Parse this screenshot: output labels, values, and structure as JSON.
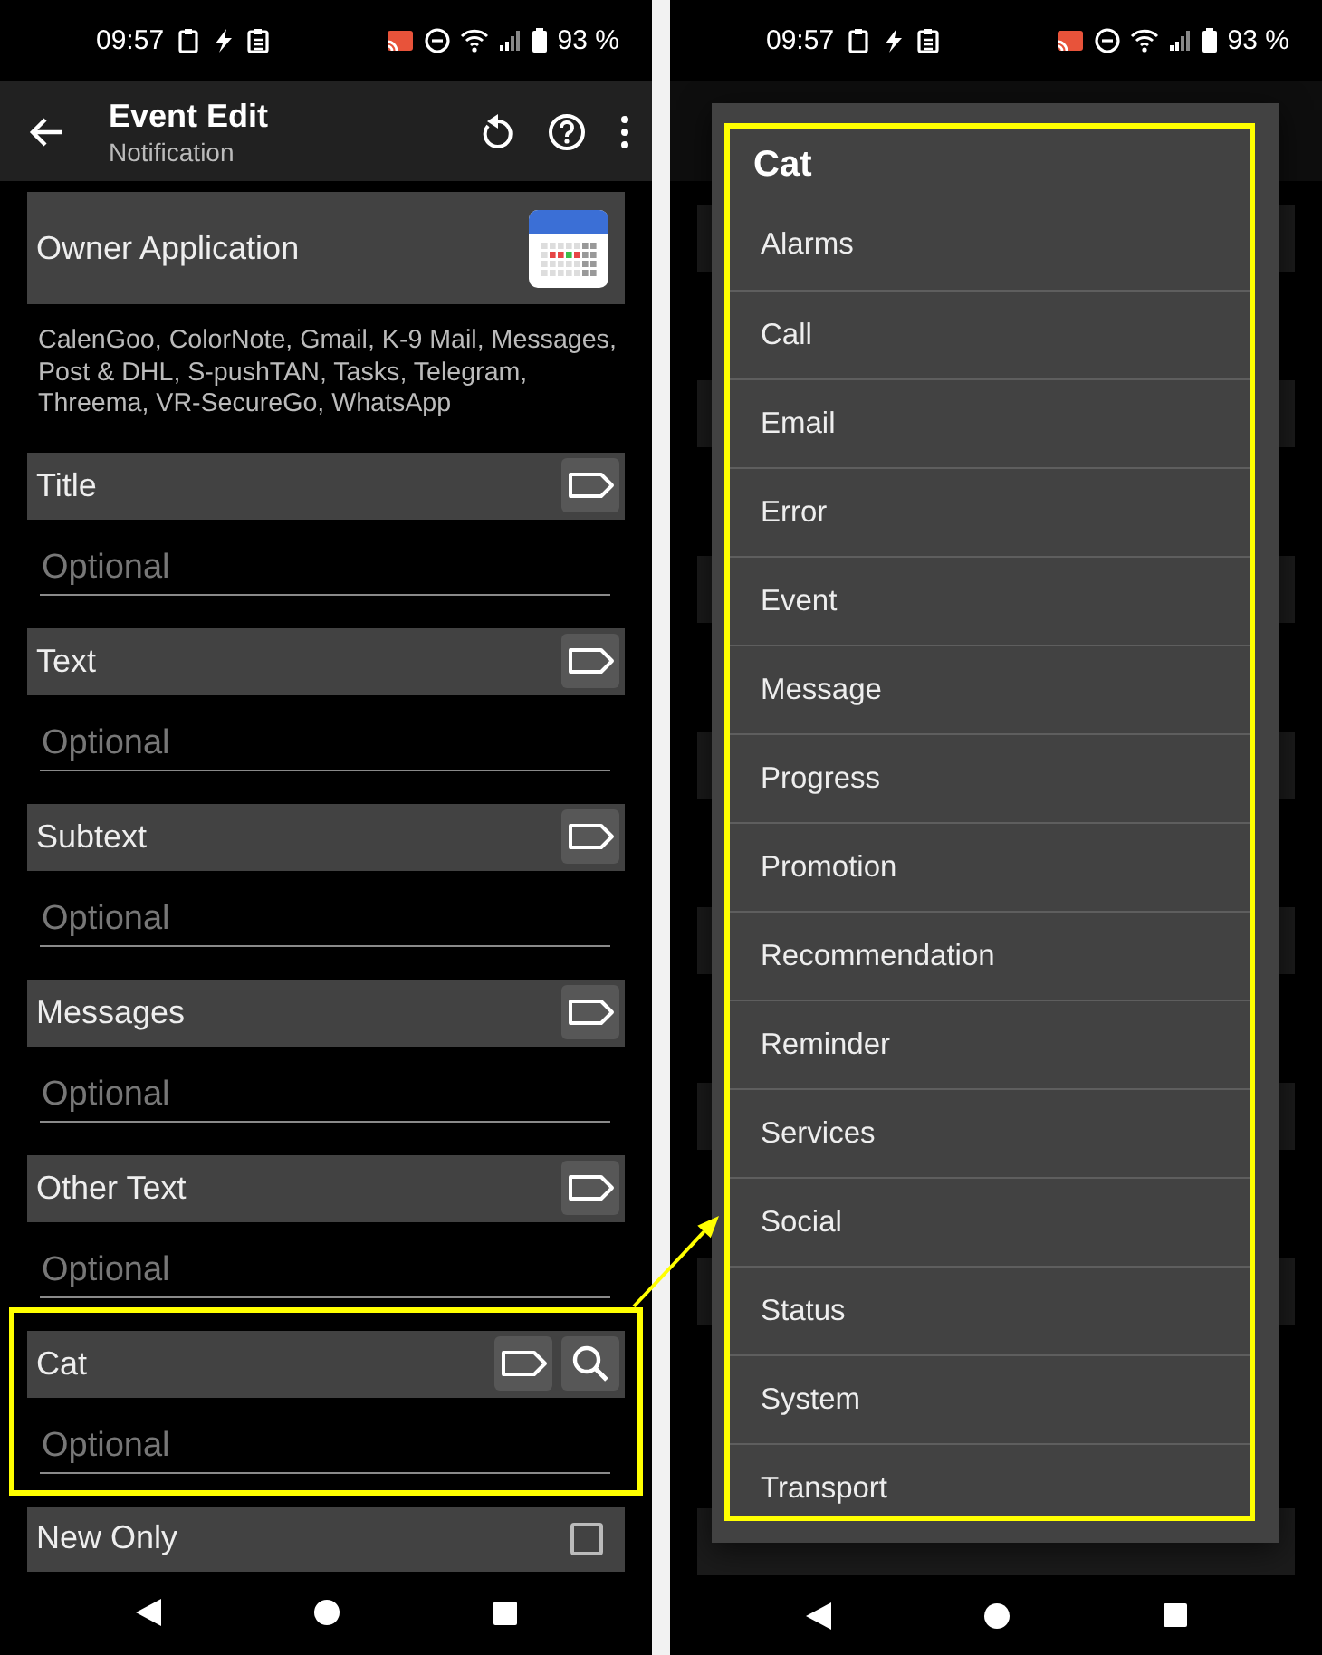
{
  "left_screen": {
    "status_bar": {
      "time": "09:57",
      "battery": "93 %"
    },
    "app_bar": {
      "title": "Event Edit",
      "subtitle": "Notification"
    },
    "owner_application": {
      "label": "Owner Application",
      "apps": "CalenGoo, ColorNote, Gmail, K-9 Mail, Messages, Post & DHL, S-pushTAN, Tasks, Telegram, Threema, VR-SecureGo, WhatsApp"
    },
    "fields": [
      {
        "label": "Title",
        "placeholder": "Optional",
        "search": false,
        "highlighted": false
      },
      {
        "label": "Text",
        "placeholder": "Optional",
        "search": false,
        "highlighted": false
      },
      {
        "label": "Subtext",
        "placeholder": "Optional",
        "search": false,
        "highlighted": false
      },
      {
        "label": "Messages",
        "placeholder": "Optional",
        "search": false,
        "highlighted": false
      },
      {
        "label": "Other Text",
        "placeholder": "Optional",
        "search": false,
        "highlighted": false
      },
      {
        "label": "Cat",
        "placeholder": "Optional",
        "search": true,
        "highlighted": true
      }
    ],
    "new_only": {
      "label": "New Only",
      "checked": false
    }
  },
  "right_screen": {
    "status_bar": {
      "time": "09:57",
      "battery": "93 %"
    },
    "dialog": {
      "title": "Cat",
      "highlighted": true,
      "items": [
        "Alarms",
        "Call",
        "Email",
        "Error",
        "Event",
        "Message",
        "Progress",
        "Promotion",
        "Recommendation",
        "Reminder",
        "Services",
        "Social",
        "Status",
        "System",
        "Transport"
      ]
    }
  }
}
